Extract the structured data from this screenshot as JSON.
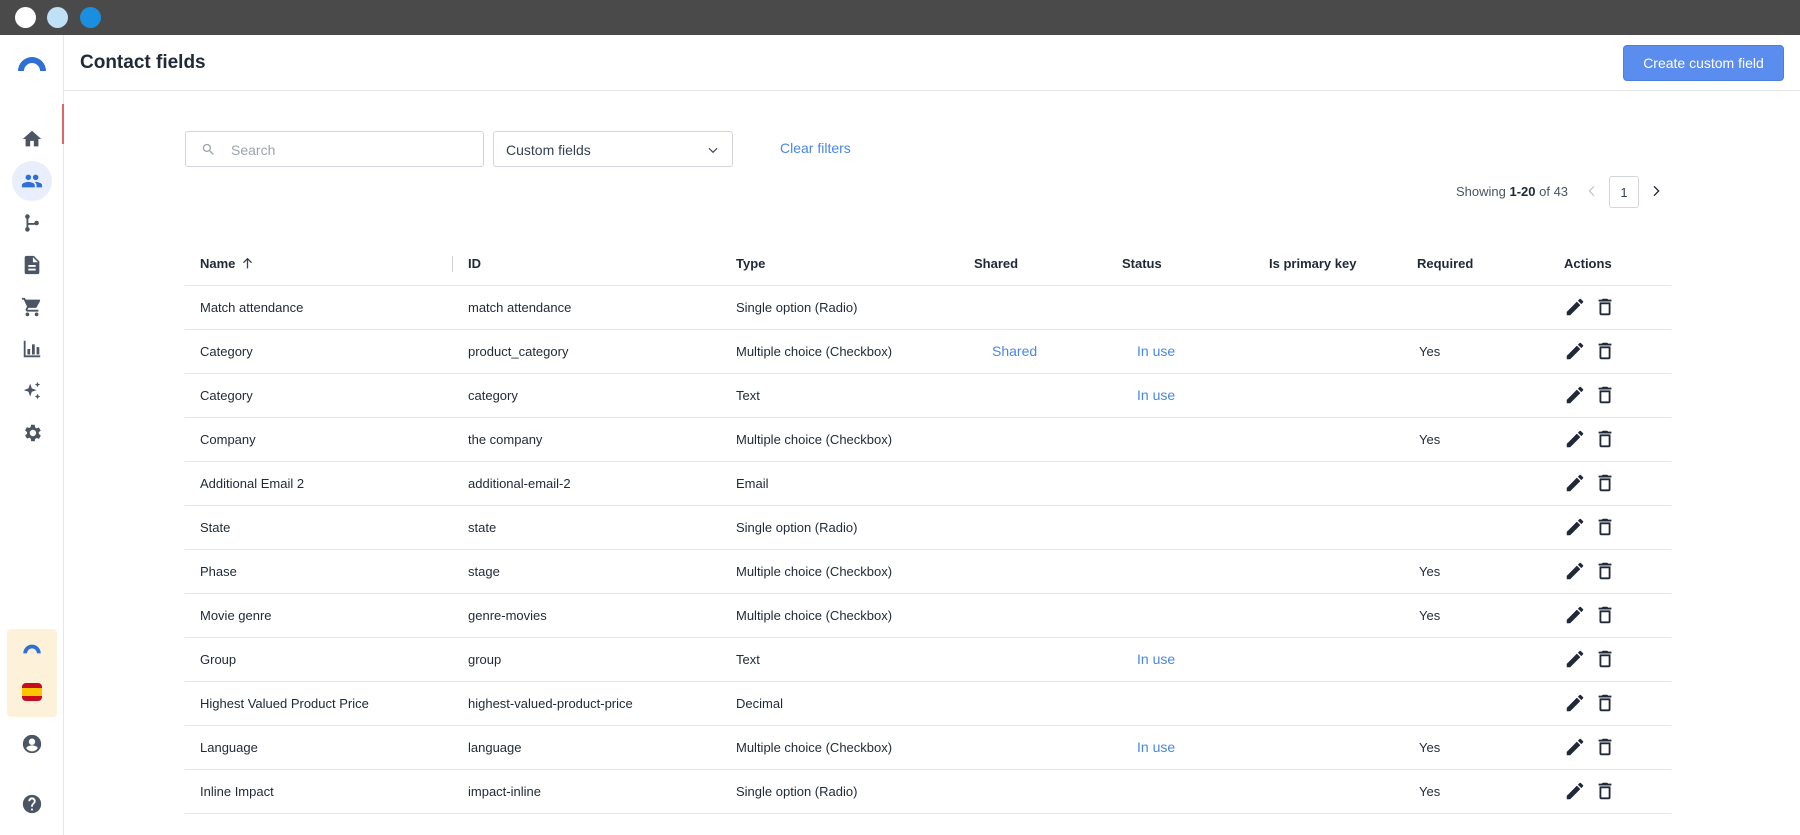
{
  "header": {
    "title": "Contact fields",
    "create_label": "Create custom field"
  },
  "sidebar": {
    "items": [
      {
        "icon": "home-icon"
      },
      {
        "icon": "contacts-icon"
      },
      {
        "icon": "automation-icon"
      },
      {
        "icon": "document-icon"
      },
      {
        "icon": "cart-icon"
      },
      {
        "icon": "chart-icon"
      },
      {
        "icon": "sparkle-icon"
      },
      {
        "icon": "gear-icon"
      }
    ],
    "bottom": [
      {
        "icon": "user-icon"
      },
      {
        "icon": "help-icon"
      }
    ]
  },
  "filters": {
    "search_placeholder": "Search",
    "select_value": "Custom fields",
    "clear_label": "Clear filters"
  },
  "pagination": {
    "prefix": "Showing ",
    "range": "1-20",
    "suffix": " of 43",
    "page": "1"
  },
  "table": {
    "columns": [
      "Name",
      "ID",
      "Type",
      "Shared",
      "Status",
      "Is primary key",
      "Required",
      "Actions"
    ],
    "rows": [
      {
        "name": "Match attendance",
        "id": "match attendance",
        "type": "Single option (Radio)",
        "shared": "",
        "status": "",
        "pk": "",
        "required": ""
      },
      {
        "name": "Category",
        "id": "product_category",
        "type": "Multiple choice (Checkbox)",
        "shared": "Shared",
        "status": "In use",
        "pk": "",
        "required": "Yes"
      },
      {
        "name": "Category",
        "id": "category",
        "type": "Text",
        "shared": "",
        "status": "In use",
        "pk": "",
        "required": ""
      },
      {
        "name": "Company",
        "id": "the company",
        "type": "Multiple choice (Checkbox)",
        "shared": "",
        "status": "",
        "pk": "",
        "required": "Yes"
      },
      {
        "name": "Additional Email 2",
        "id": "additional-email-2",
        "type": "Email",
        "shared": "",
        "status": "",
        "pk": "",
        "required": ""
      },
      {
        "name": "State",
        "id": "state",
        "type": "Single option (Radio)",
        "shared": "",
        "status": "",
        "pk": "",
        "required": ""
      },
      {
        "name": "Phase",
        "id": "stage",
        "type": "Multiple choice (Checkbox)",
        "shared": "",
        "status": "",
        "pk": "",
        "required": "Yes"
      },
      {
        "name": "Movie genre",
        "id": "genre-movies",
        "type": "Multiple choice (Checkbox)",
        "shared": "",
        "status": "",
        "pk": "",
        "required": "Yes"
      },
      {
        "name": "Group",
        "id": "group",
        "type": "Text",
        "shared": "",
        "status": "In use",
        "pk": "",
        "required": ""
      },
      {
        "name": "Highest Valued Product Price",
        "id": "highest-valued-product-price",
        "type": "Decimal",
        "shared": "",
        "status": "",
        "pk": "",
        "required": ""
      },
      {
        "name": "Language",
        "id": "language",
        "type": "Multiple choice (Checkbox)",
        "shared": "",
        "status": "In use",
        "pk": "",
        "required": "Yes"
      },
      {
        "name": "Inline Impact",
        "id": "impact-inline",
        "type": "Single option (Radio)",
        "shared": "",
        "status": "",
        "pk": "",
        "required": "Yes"
      }
    ]
  },
  "colors": {
    "accent": "#5b8def",
    "link": "#4a86e8",
    "titlebar": "#4a4a4a"
  }
}
